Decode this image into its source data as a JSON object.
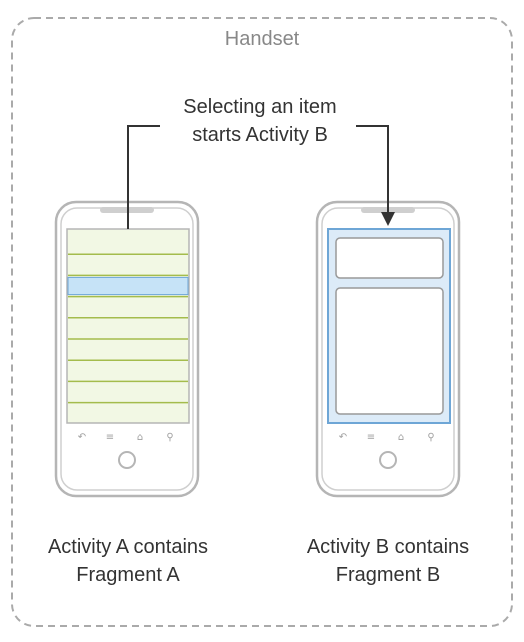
{
  "frame": {
    "title": "Handset"
  },
  "annotation": {
    "line1": "Selecting an item",
    "line2": "starts Activity B"
  },
  "phone_a": {
    "caption_line1": "Activity A contains",
    "caption_line2": "Fragment A",
    "list_item_count": 9,
    "selected_index": 2
  },
  "phone_b": {
    "caption_line1": "Activity B contains",
    "caption_line2": "Fragment B"
  },
  "colors": {
    "frame_border": "#aaaaaa",
    "phone_outline": "#b5b5b5",
    "list_background": "#f2f8e4",
    "list_divider": "#a4bc4c",
    "selected_item": "#c6e3f7",
    "screen_border": "#6ea6d6",
    "activity_background": "#dcebf8",
    "fragment_border": "#999999",
    "arrow": "#333333"
  }
}
